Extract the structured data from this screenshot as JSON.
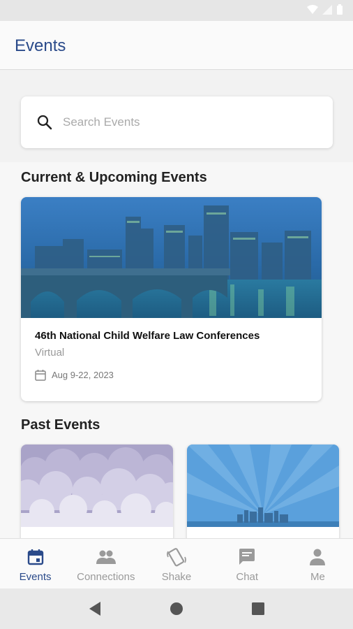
{
  "app": {
    "title": "Events"
  },
  "search": {
    "placeholder": "Search Events",
    "value": ""
  },
  "current_section": {
    "title": "Current & Upcoming Events"
  },
  "current_events": [
    {
      "name": "46th National Child Welfare Law Conferences",
      "location": "Virtual",
      "date": "Aug  9-22, 2023"
    }
  ],
  "past_section": {
    "title": "Past Events"
  },
  "bottom_nav": {
    "items": [
      {
        "label": "Events",
        "icon": "calendar-icon",
        "active": true
      },
      {
        "label": "Connections",
        "icon": "people-icon",
        "active": false
      },
      {
        "label": "Shake",
        "icon": "shake-phone-icon",
        "active": false
      },
      {
        "label": "Chat",
        "icon": "chat-bubble-icon",
        "active": false
      },
      {
        "label": "Me",
        "icon": "person-icon",
        "active": false
      }
    ]
  },
  "colors": {
    "accent": "#2a4a8a",
    "inactive": "#9a9a9a",
    "status_bar": "#e6e6e6"
  }
}
